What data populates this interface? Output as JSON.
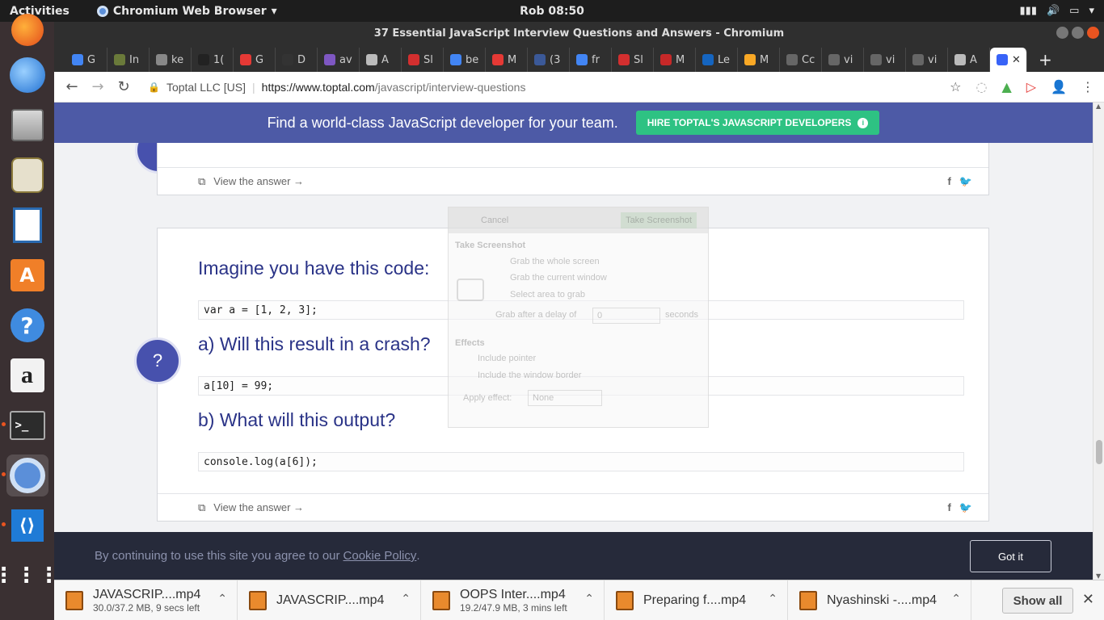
{
  "topbar": {
    "activities": "Activities",
    "app_menu": "Chromium Web Browser",
    "clock": "Rob 08:50"
  },
  "window": {
    "title": "37 Essential JavaScript Interview Questions and Answers - Chromium"
  },
  "tabs": [
    {
      "label": "G",
      "color": "#4285f4"
    },
    {
      "label": "In",
      "color": "#6a7a3a"
    },
    {
      "label": "ke",
      "color": "#888888"
    },
    {
      "label": "1(",
      "color": "#222222"
    },
    {
      "label": "G",
      "color": "#e53935"
    },
    {
      "label": "D",
      "color": "#333333"
    },
    {
      "label": "av",
      "color": "#7e57c2"
    },
    {
      "label": "A",
      "color": "#bbbbbb"
    },
    {
      "label": "Sl",
      "color": "#d32f2f"
    },
    {
      "label": "be",
      "color": "#4285f4"
    },
    {
      "label": "M",
      "color": "#e53935"
    },
    {
      "label": "(3",
      "color": "#3b5998"
    },
    {
      "label": "fr",
      "color": "#4285f4"
    },
    {
      "label": "Sl",
      "color": "#d32f2f"
    },
    {
      "label": "M",
      "color": "#c62828"
    },
    {
      "label": "Le",
      "color": "#1565c0"
    },
    {
      "label": "M",
      "color": "#f9a825"
    },
    {
      "label": "Cc",
      "color": "#666666"
    },
    {
      "label": "vi",
      "color": "#666666"
    },
    {
      "label": "vi",
      "color": "#666666"
    },
    {
      "label": "vi",
      "color": "#666666"
    },
    {
      "label": "A",
      "color": "#bbbbbb"
    }
  ],
  "active_tab": {
    "icon": "toptal-icon",
    "color": "#3863f7"
  },
  "address": {
    "site_name": "Toptal LLC [US]",
    "url_host": "https://www.toptal.com",
    "url_path": "/javascript/interview-questions"
  },
  "promo": {
    "message": "Find a world-class JavaScript developer for your team.",
    "button": "HIRE TOPTAL'S JAVASCRIPT DEVELOPERS",
    "accent": "#4d5aa6",
    "button_color": "#2ec283"
  },
  "cards": {
    "top_footer": {
      "view_answer": "View the answer →"
    },
    "question": {
      "heading_1": "Imagine you have this code:",
      "code_1": "var a = [1, 2, 3];",
      "heading_2": "a) Will this result in a crash?",
      "code_2": "a[10] = 99;",
      "heading_3": "b) What will this output?",
      "code_3": "console.log(a[6]);",
      "badge": "?",
      "view_answer": "View the answer →"
    },
    "share": {
      "facebook": "f",
      "twitter": "🐦"
    }
  },
  "screenshot_dialog": {
    "cancel": "Cancel",
    "take": "Take Screenshot",
    "section_1": "Take Screenshot",
    "opt_1": "Grab the whole screen",
    "opt_2": "Grab the current window",
    "opt_3": "Select area to grab",
    "delay_label": "Grab after a delay of",
    "delay_value": "0",
    "delay_unit": "seconds",
    "section_2": "Effects",
    "eff_1": "Include pointer",
    "eff_2": "Include the window border",
    "apply_label": "Apply effect:",
    "apply_value": "None"
  },
  "cookie": {
    "text": "By continuing to use this site you agree to our",
    "link": "Cookie Policy",
    "period": ".",
    "button": "Got it"
  },
  "downloads": [
    {
      "name": "JAVASCRIP....mp4",
      "status": "30.0/37.2 MB, 9 secs left"
    },
    {
      "name": "JAVASCRIP....mp4",
      "status": ""
    },
    {
      "name": "OOPS Inter....mp4",
      "status": "19.2/47.9 MB, 3 mins left"
    },
    {
      "name": "Preparing f....mp4",
      "status": ""
    },
    {
      "name": "Nyashinski -....mp4",
      "status": ""
    }
  ],
  "download_bar": {
    "show_all": "Show all"
  }
}
